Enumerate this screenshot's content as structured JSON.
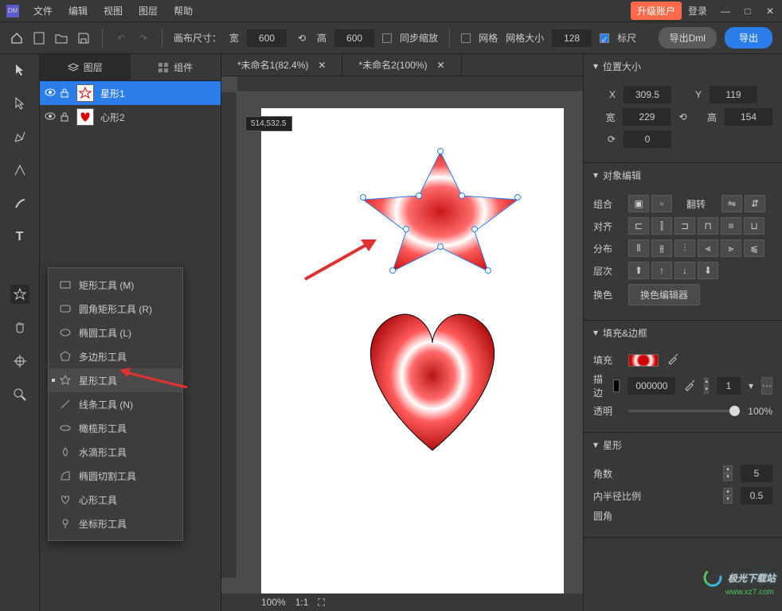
{
  "app": {
    "logo": "DM"
  },
  "menus": [
    "文件",
    "编辑",
    "视图",
    "图层",
    "帮助"
  ],
  "titlebar": {
    "upgrade": "升级账户",
    "login": "登录"
  },
  "toolbar": {
    "canvas_size": "画布尺寸：",
    "width_lbl": "宽",
    "width": "600",
    "height_lbl": "高",
    "height": "600",
    "sync": "同步缩放",
    "grid": "网格",
    "grid_size": "网格大小",
    "grid_val": "128",
    "ruler": "标尺",
    "export_dml": "导出Dml",
    "export": "导出"
  },
  "lefttabs": {
    "layers": "图层",
    "components": "组件"
  },
  "layers": [
    {
      "name": "星形1"
    },
    {
      "name": "心形2"
    }
  ],
  "docs": [
    {
      "name": "*未命名1(82.4%)"
    },
    {
      "name": "*未命名2(100%)"
    }
  ],
  "status": {
    "zoom": "100%",
    "ratio": "1:1",
    "coords": "514,532.5"
  },
  "right": {
    "pos_size": "位置大小",
    "x_lbl": "X",
    "x": "309.5",
    "y_lbl": "Y",
    "y": "119",
    "w_lbl": "宽",
    "w": "229",
    "h_lbl": "高",
    "h": "154",
    "rot": "0",
    "obj_edit": "对象编辑",
    "combine": "组合",
    "flip": "翻转",
    "align": "对齐",
    "distribute": "分布",
    "order": "层次",
    "recolor": "换色",
    "recolor_editor": "换色编辑器",
    "fill_stroke": "填充&边框",
    "fill": "填充",
    "stroke": "描边",
    "stroke_color": "000000",
    "stroke_w": "1",
    "opacity": "透明",
    "opacity_val": "100%",
    "star": "星形",
    "points": "角数",
    "points_val": "5",
    "inner": "内半径比例",
    "inner_val": "0.5",
    "round": "圆角"
  },
  "shape_menu": [
    {
      "label": "矩形工具 (M)"
    },
    {
      "label": "圆角矩形工具 (R)"
    },
    {
      "label": "椭圆工具 (L)"
    },
    {
      "label": "多边形工具"
    },
    {
      "label": "星形工具",
      "hover": true
    },
    {
      "label": "线条工具 (N)"
    },
    {
      "label": "橄榄形工具"
    },
    {
      "label": "水滴形工具"
    },
    {
      "label": "椭圆切割工具"
    },
    {
      "label": "心形工具"
    },
    {
      "label": "坐标形工具"
    }
  ],
  "watermark": {
    "main": "极光下载站",
    "sub": "www.xz7.com"
  }
}
